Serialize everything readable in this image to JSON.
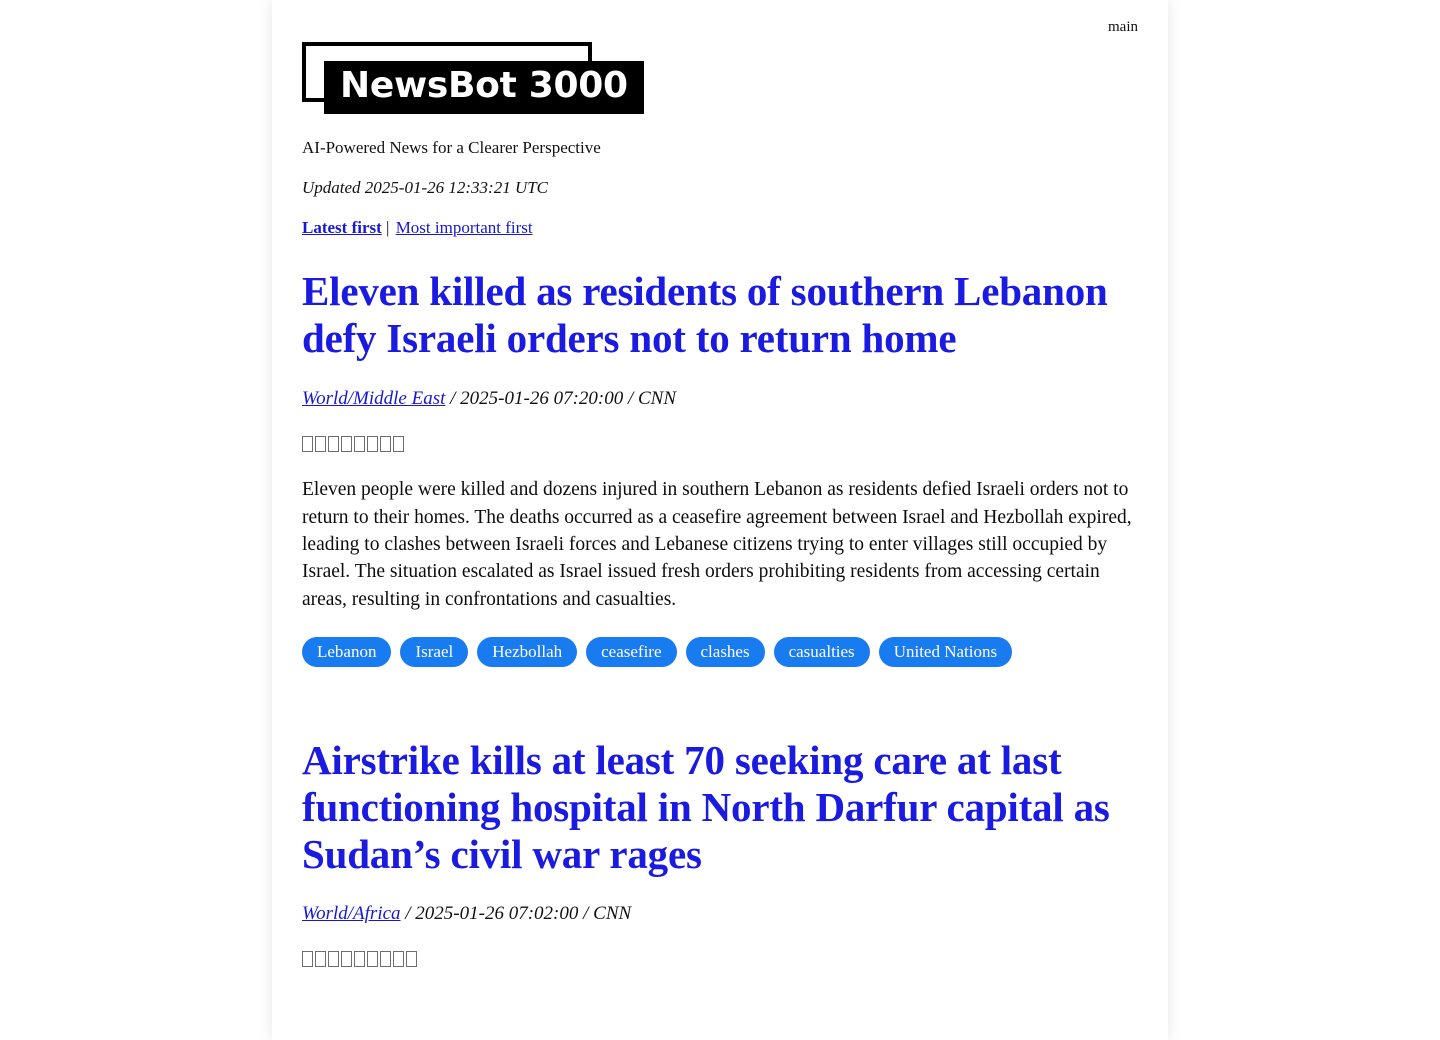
{
  "branch": {
    "label": "main"
  },
  "header": {
    "logo_text": "NewsBot 3000",
    "tagline": "AI-Powered News for a Clearer Perspective",
    "updated": "Updated 2025-01-26 12:33:21 UTC"
  },
  "sort": {
    "latest_label": "Latest first",
    "separator": "|",
    "important_label": "Most important first",
    "active": "Latest first"
  },
  "colors": {
    "headline_blue": "#1a1ae0",
    "link_blue": "#1717d6",
    "tag_blue": "#187bf0",
    "text_black": "#111111",
    "page_background": "#ffffff"
  },
  "articles": [
    {
      "title": "Eleven killed as residents of southern Lebanon defy Israeli orders not to return home",
      "category": "World/Middle East",
      "meta_rest": "/ 2025-01-26 07:20:00 / CNN",
      "timestamp": "2025-01-26 07:20:00",
      "source": "CNN",
      "glyph_count": 8,
      "body": "Eleven people were killed and dozens injured in southern Lebanon as residents defied Israeli orders not to return to their homes. The deaths occurred as a ceasefire agreement between Israel and Hezbollah expired, leading to clashes between Israeli forces and Lebanese citizens trying to enter villages still occupied by Israel. The situation escalated as Israel issued fresh orders prohibiting residents from accessing certain areas, resulting in confrontations and casualties.",
      "tags": [
        "Lebanon",
        "Israel",
        "Hezbollah",
        "ceasefire",
        "clashes",
        "casualties",
        "United Nations"
      ]
    },
    {
      "title": "Airstrike kills at least 70 seeking care at last functioning hospital in North Darfur capital as Sudan’s civil war rages",
      "category": "World/Africa",
      "meta_rest": "/ 2025-01-26 07:02:00 / CNN",
      "timestamp": "2025-01-26 07:02:00",
      "source": "CNN",
      "glyph_count": 9,
      "body": "",
      "tags": []
    }
  ]
}
